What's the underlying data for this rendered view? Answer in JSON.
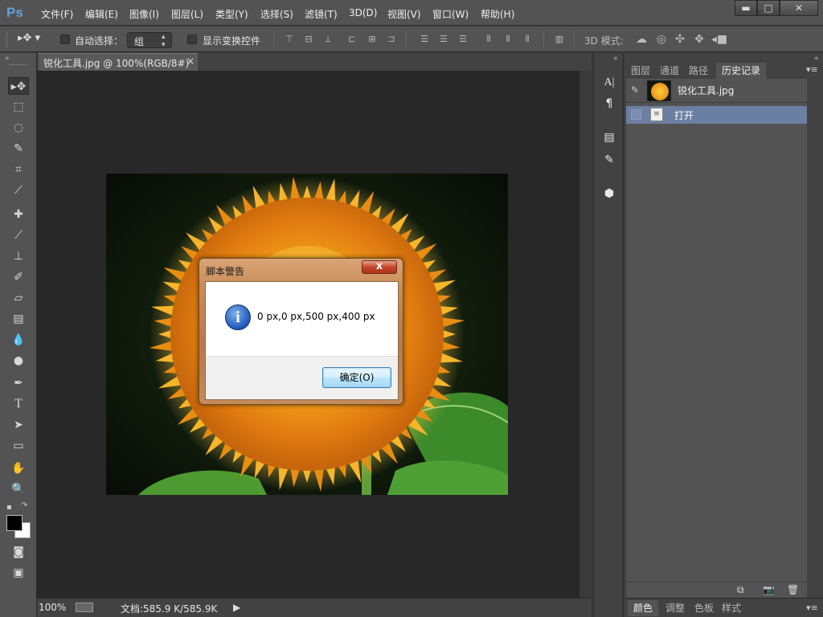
{
  "app": {
    "logo": "Ps"
  },
  "menu": [
    "文件(F)",
    "编辑(E)",
    "图像(I)",
    "图层(L)",
    "类型(Y)",
    "选择(S)",
    "滤镜(T)",
    "3D(D)",
    "视图(V)",
    "窗口(W)",
    "帮助(H)"
  ],
  "window_buttons": {
    "minimize": "▬",
    "maximize": "□",
    "close": "✕"
  },
  "options": {
    "auto_select_label": "自动选择：",
    "group_value": "组",
    "show_transform_label": "显示变换控件",
    "mode_3d_label": "3D 模式:"
  },
  "document": {
    "tab_title": "锐化工具.jpg @ 100%(RGB/8#)",
    "tab_close": "×",
    "zoom": "100%",
    "doc_info": "文档:585.9 K/585.9K"
  },
  "panel": {
    "tabs": [
      "图层",
      "通道",
      "路径",
      "历史记录"
    ],
    "active_tab": 3,
    "snapshot_name": "锐化工具.jpg",
    "history_items": [
      "打开"
    ],
    "bottom_tabs": [
      "颜色",
      "调整",
      "色板",
      "样式"
    ]
  },
  "dialog": {
    "title": "脚本警告",
    "message": "0 px,0 px,500 px,400 px",
    "ok_label": "确定(O)",
    "close_label": "x"
  },
  "colors": {
    "ui_dark": "#535353",
    "canvas_bg": "#282828",
    "selection": "#6b7fa3"
  }
}
